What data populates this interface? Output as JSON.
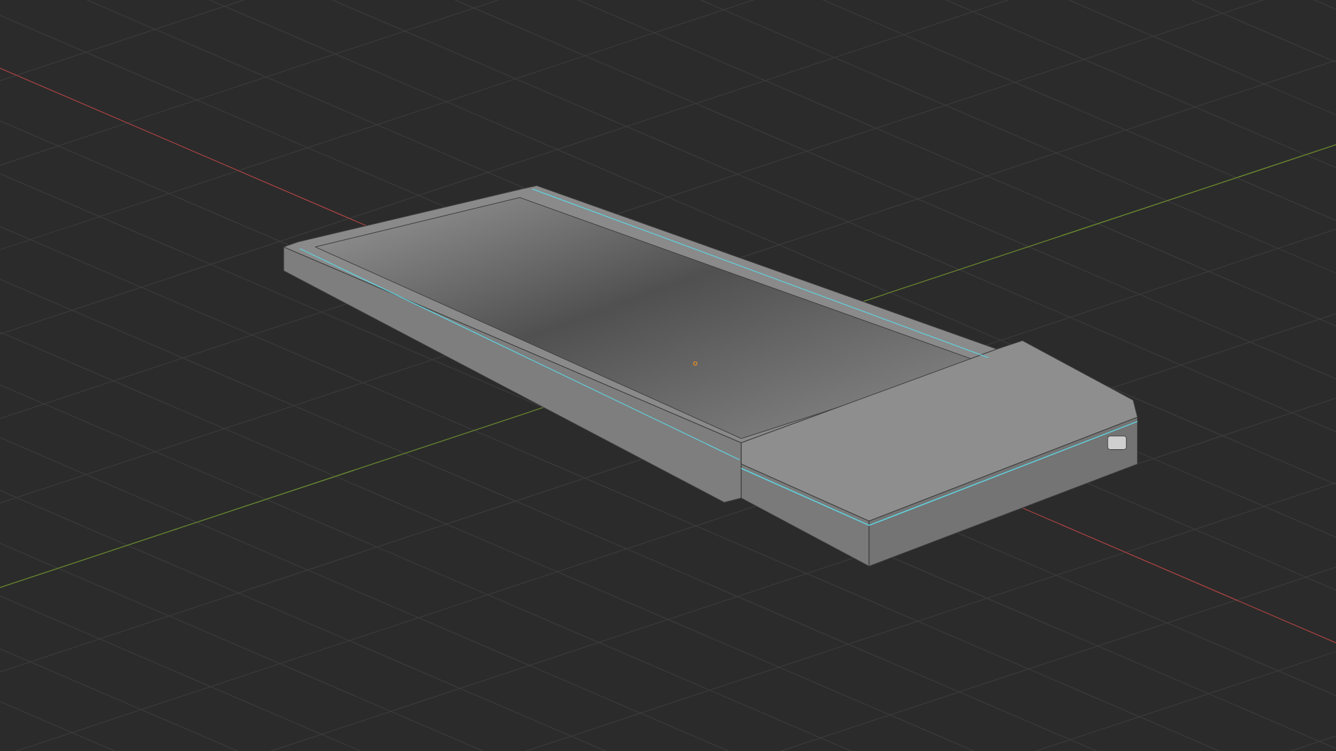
{
  "viewport": {
    "axes": [
      {
        "kind": "x",
        "color": "#a8403f"
      },
      {
        "kind": "y",
        "color": "#6a8a2c"
      }
    ]
  }
}
